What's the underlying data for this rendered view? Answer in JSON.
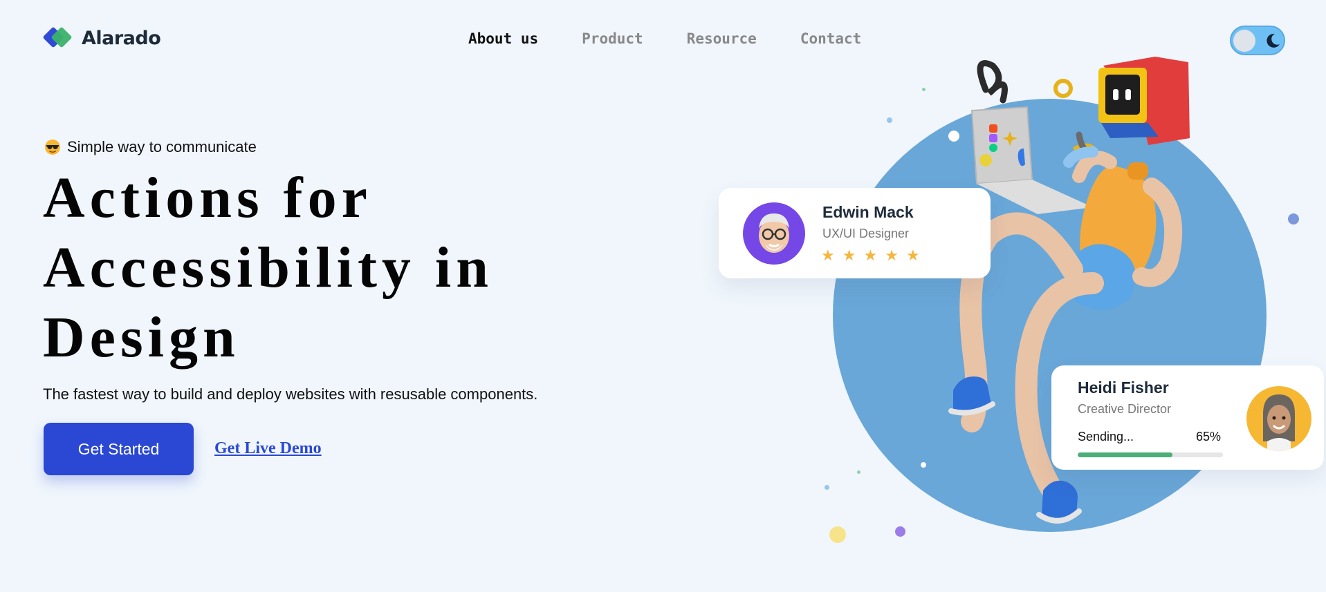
{
  "brand": {
    "name": "Alarado"
  },
  "nav": {
    "items": [
      {
        "label": "About us",
        "active": true
      },
      {
        "label": "Product",
        "active": false
      },
      {
        "label": "Resource",
        "active": false
      },
      {
        "label": "Contact",
        "active": false
      }
    ]
  },
  "theme_toggle": {
    "icon": "moon-icon",
    "mode": "dark"
  },
  "hero": {
    "tagline_icon": "sunglasses-emoji-icon",
    "tagline": "Simple way to communicate",
    "headline": [
      "Actions for",
      "Accessibility in",
      "Design"
    ],
    "subtext": "The fastest way to build and deploy websites with resusable components.",
    "primary_button": "Get Started",
    "secondary_link": "Get Live Demo"
  },
  "cards": {
    "edwin": {
      "name": "Edwin Mack",
      "role": "UX/UI Designer",
      "rating": 5
    },
    "heidi": {
      "name": "Heidi Fisher",
      "role": "Creative Director",
      "status": "Sending...",
      "progress_label": "65%",
      "progress": 0.65
    }
  },
  "colors": {
    "primary": "#2a48d3",
    "brand_blue": "#2f4bd6",
    "brand_green": "#3bb26a",
    "circle": "#69a7d8",
    "star": "#f4b63f",
    "progress": "#4caf7a"
  }
}
